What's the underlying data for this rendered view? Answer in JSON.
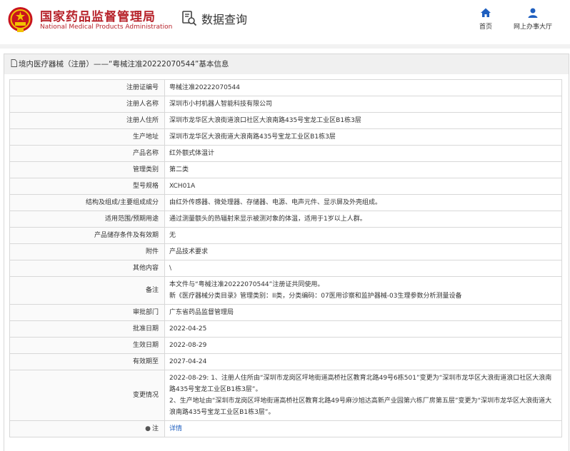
{
  "header": {
    "site_name_cn": "国家药品监督管理局",
    "site_name_en": "National Medical Products Administration",
    "page_title": "数据查询",
    "nav": {
      "home": "首页",
      "online_hall": "网上办事大厅"
    }
  },
  "panel": {
    "title": "境内医疗器械（注册）——“粤械注准20222070544”基本信息"
  },
  "rows": [
    {
      "label": "注册证编号",
      "value": "粤械注准20222070544"
    },
    {
      "label": "注册人名称",
      "value": "深圳市小村机器人智能科技有限公司"
    },
    {
      "label": "注册人住所",
      "value": "深圳市龙华区大浪街道浪口社区大浪南路435号宝龙工业区B1栋3层"
    },
    {
      "label": "生产地址",
      "value": "深圳市龙华区大浪街道大浪南路435号宝龙工业区B1栋3层"
    },
    {
      "label": "产品名称",
      "value": "红外额式体温计"
    },
    {
      "label": "管理类别",
      "value": "第二类"
    },
    {
      "label": "型号规格",
      "value": "XCH01A"
    },
    {
      "label": "结构及组成/主要组成成分",
      "value": "由红外传感器、微处理器、存储器、电源、电声元件、显示屏及外壳组成。"
    },
    {
      "label": "适用范围/预期用途",
      "value": "通过测量额头的热辐射来显示被测对象的体温，适用于1岁以上人群。"
    },
    {
      "label": "产品储存条件及有效期",
      "value": "无"
    },
    {
      "label": "附件",
      "value": "产品技术要求"
    },
    {
      "label": "其他内容",
      "value": "\\"
    },
    {
      "label": "备注",
      "line1": "本文件与“粤械注准20222070544”注册证共同使用。",
      "line2": "新《医疗器械分类目录》管理类别：II类，分类编码：07医用诊察和监护器械-03生理参数分析测量设备"
    },
    {
      "label": "审批部门",
      "value": "广东省药品监督管理局"
    },
    {
      "label": "批准日期",
      "value": "2022-04-25"
    },
    {
      "label": "生效日期",
      "value": "2022-08-29"
    },
    {
      "label": "有效期至",
      "value": "2027-04-24"
    },
    {
      "label": "变更情况",
      "line1": "2022-08-29: 1、注册人住所由“深圳市龙岗区坪地街道高桥社区教育北路49号6栋501”变更为“深圳市龙华区大浪街道浪口社区大浪南路435号宝龙工业区B1栋3层”。",
      "line2": "2、生产地址由“深圳市龙岗区坪地街道高桥社区教育北路49号麻沙旭达高新产业园第六栋厂房第五层”变更为“深圳市龙华区大浪街道大浪南路435号宝龙工业区B1栋3层”。"
    },
    {
      "label": "注",
      "value": "详情"
    }
  ],
  "colors": {
    "brand_red": "#b7232b",
    "nav_blue": "#1f5fbf",
    "link_blue": "#1f5fbf"
  },
  "icons": [
    "national-emblem-icon",
    "search-doc-icon",
    "home-icon",
    "user-icon",
    "document-icon",
    "lightbulb-icon"
  ]
}
